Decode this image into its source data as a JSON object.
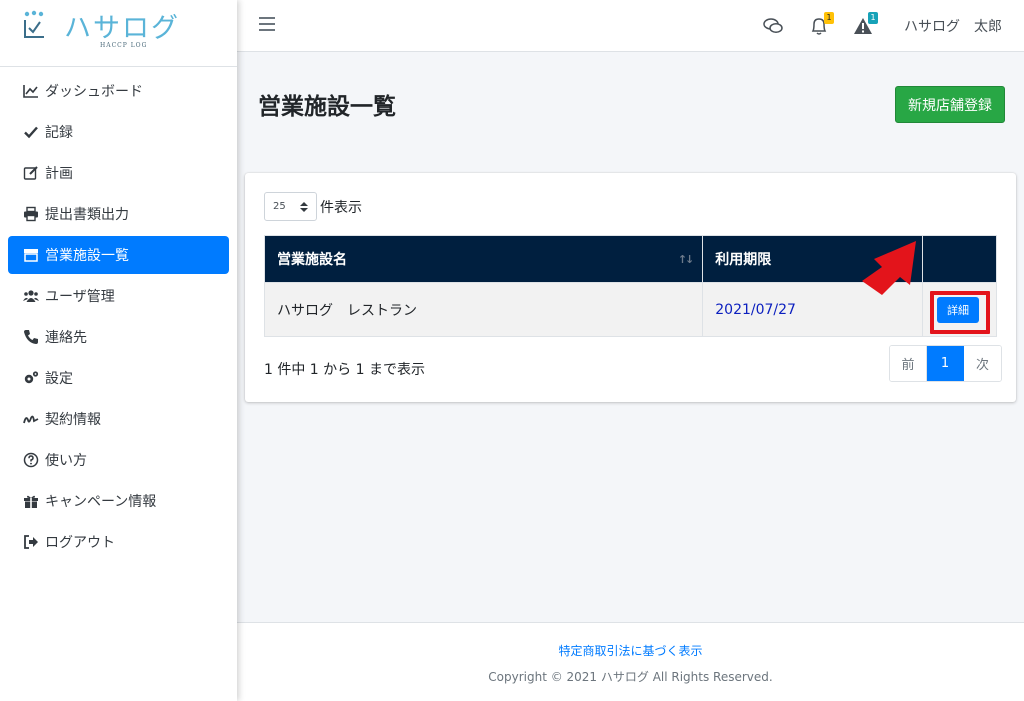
{
  "brand": {
    "name": "ハサログ",
    "sub": "HACCP LOG"
  },
  "sidebar": {
    "items": [
      {
        "label": "ダッシュボード",
        "icon": "chart-line-icon"
      },
      {
        "label": "記録",
        "icon": "check-icon"
      },
      {
        "label": "計画",
        "icon": "edit-icon"
      },
      {
        "label": "提出書類出力",
        "icon": "printer-icon"
      },
      {
        "label": "営業施設一覧",
        "icon": "store-icon",
        "active": true
      },
      {
        "label": "ユーザ管理",
        "icon": "users-icon"
      },
      {
        "label": "連絡先",
        "icon": "phone-icon"
      },
      {
        "label": "設定",
        "icon": "gears-icon"
      },
      {
        "label": "契約情報",
        "icon": "signature-icon"
      },
      {
        "label": "使い方",
        "icon": "question-circle-icon"
      },
      {
        "label": "キャンペーン情報",
        "icon": "gift-icon"
      },
      {
        "label": "ログアウト",
        "icon": "logout-icon"
      }
    ]
  },
  "header": {
    "notifications_count": "1",
    "alerts_count": "1",
    "user_name": "ハサログ　太郎"
  },
  "main": {
    "title": "営業施設一覧",
    "new_button": "新規店舗登録",
    "page_length": "25",
    "page_length_label": "件表示",
    "columns": [
      "営業施設名",
      "利用期限",
      ""
    ],
    "rows": [
      {
        "name": "ハサログ　レストラン",
        "expiry": "2021/07/27",
        "action": "詳細"
      }
    ],
    "info": "1 件中 1 から 1 まで表示",
    "pager": {
      "prev": "前",
      "current": "1",
      "next": "次"
    }
  },
  "footer": {
    "link": "特定商取引法に基づく表示",
    "copyright": "Copyright © 2021 ハサログ All Rights Reserved."
  },
  "colors": {
    "primary": "#007bff",
    "success": "#28a745",
    "table_header": "#001f3f",
    "highlight": "#e3141b"
  }
}
